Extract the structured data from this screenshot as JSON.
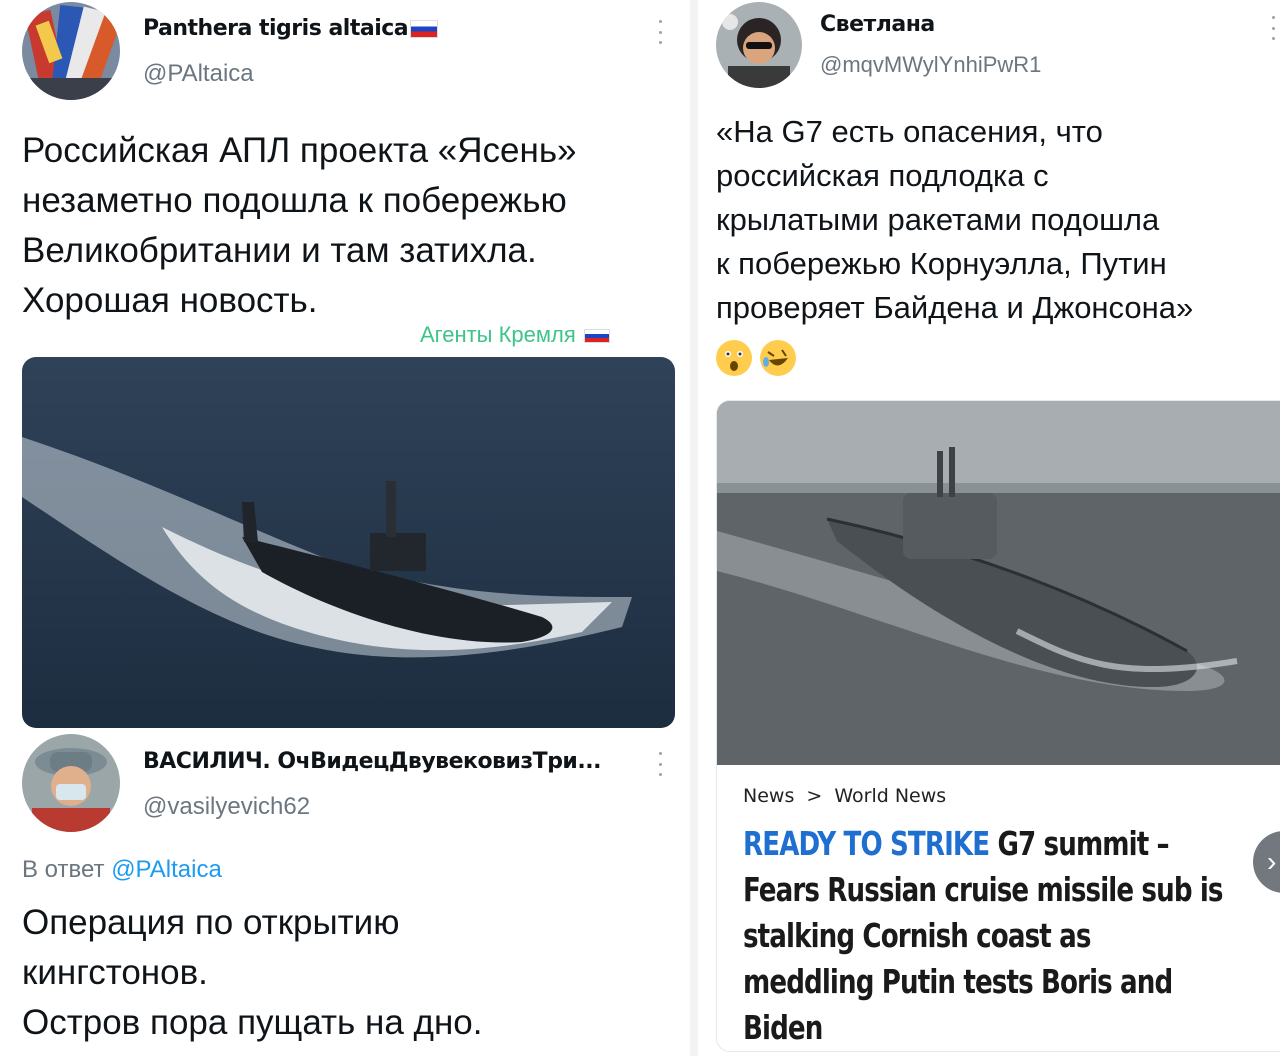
{
  "tweet1": {
    "name": "Panthera tigris altaica",
    "handle": "@PAltaica",
    "lines": [
      "Российская АПЛ проекта «Ясень»",
      "незаметно подошла к побережью",
      "Великобритании и там затихла.",
      "Хорошая новость."
    ],
    "watermark": "Агенты Кремля"
  },
  "tweet2": {
    "name": "ВАСИЛИЧ. ОчВидецДвувековизТри...",
    "handle": "@vasilyevich62",
    "reply_prefix": "В ответ",
    "reply_handle": "@PAltaica",
    "lines": [
      "Операция по открытию",
      "кингстонов.",
      "Остров пора пущать на дно."
    ]
  },
  "tweet3": {
    "name": "Светлана",
    "handle": "@mqvMWylYnhiPwR1",
    "lines": [
      "«На G7 есть опасения, что",
      "российская подлодка с",
      "крылатыми ракетами подошла",
      "к побережью Корнуэлла, Путин",
      "проверяет Байдена и Джонсона»"
    ],
    "emoji": [
      "astonished-face",
      "rolling-on-floor-laughing"
    ]
  },
  "article": {
    "breadcrumb_1": "News",
    "breadcrumb_sep": ">",
    "breadcrumb_2": "World News",
    "headline_accent": "READY TO STRIKE",
    "headline_line1_rest": " G7 summit –",
    "headline_line2": "Fears Russian cruise missile sub is",
    "headline_line3": "stalking Cornish coast as",
    "headline_line4": "meddling Putin tests Boris and",
    "headline_line5": "Biden"
  },
  "colors": {
    "link": "#1d9bf0",
    "accent": "#1f6fd1",
    "watermark": "#3cc48a",
    "muted": "#6b7680"
  }
}
